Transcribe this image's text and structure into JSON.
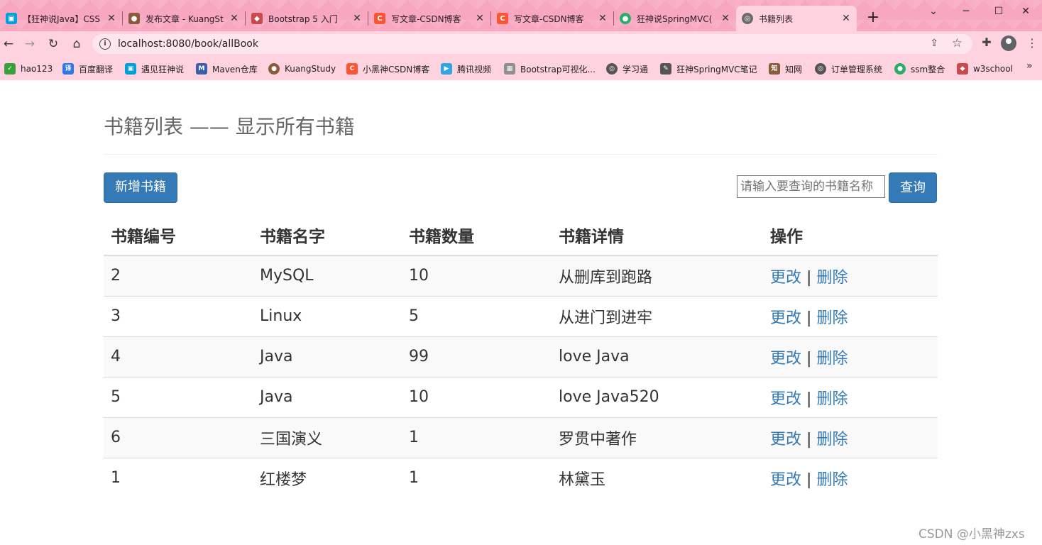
{
  "browser": {
    "tabs": [
      {
        "title": "【狂神说Java】CSS",
        "icon": "bilibili-icon",
        "color": "#00a1d6"
      },
      {
        "title": "发布文章 - KuangSt",
        "icon": "avatar-icon",
        "color": "#8a5a3c"
      },
      {
        "title": "Bootstrap 5 入门",
        "icon": "runoob-icon",
        "color": "#c84a4a"
      },
      {
        "title": "写文章-CSDN博客",
        "icon": "csdn-icon",
        "color": "#fc5531"
      },
      {
        "title": "写文章-CSDN博客",
        "icon": "csdn-icon",
        "color": "#fc5531"
      },
      {
        "title": "狂神说SpringMVC(",
        "icon": "wechat-icon",
        "color": "#2aae67"
      },
      {
        "title": "书籍列表",
        "icon": "globe-icon",
        "color": "#6b6b6b",
        "active": true
      }
    ],
    "url": "localhost:8080/book/allBook",
    "bookmarks": [
      {
        "label": "hao123",
        "icon": "hao123-icon",
        "color": "#3aa13a"
      },
      {
        "label": "百度翻译",
        "icon": "baidu-translate-icon",
        "color": "#2e77e8"
      },
      {
        "label": "遇见狂神说",
        "icon": "bilibili-icon",
        "color": "#00a1d6"
      },
      {
        "label": "Maven仓库",
        "icon": "maven-icon",
        "color": "#3b5fa8"
      },
      {
        "label": "KuangStudy",
        "icon": "avatar-icon",
        "color": "#8a5a3c"
      },
      {
        "label": "小黑神CSDN博客",
        "icon": "csdn-icon",
        "color": "#fc5531"
      },
      {
        "label": "腾讯视频",
        "icon": "tencent-video-icon",
        "color": "#2ea7e0"
      },
      {
        "label": "Bootstrap可视化...",
        "icon": "grid-icon",
        "color": "#8f8f8f"
      },
      {
        "label": "学习通",
        "icon": "globe-icon",
        "color": "#555555"
      },
      {
        "label": "狂神SpringMVC笔记",
        "icon": "feather-icon",
        "color": "#555555"
      },
      {
        "label": "知网",
        "icon": "cnki-icon",
        "color": "#8a5a3c"
      },
      {
        "label": "订单管理系统",
        "icon": "globe-icon",
        "color": "#555555"
      },
      {
        "label": "ssm整合",
        "icon": "wechat-icon",
        "color": "#2aae67"
      },
      {
        "label": "w3school",
        "icon": "runoob-icon",
        "color": "#c84a4a"
      }
    ]
  },
  "page": {
    "title": "书籍列表 —— 显示所有书籍",
    "add_button": "新增书籍",
    "search_placeholder": "请输入要查询的书籍名称",
    "search_button": "查询",
    "table": {
      "headers": [
        "书籍编号",
        "书籍名字",
        "书籍数量",
        "书籍详情",
        "操作"
      ],
      "rows": [
        {
          "id": "2",
          "name": "MySQL",
          "count": "10",
          "detail": "从删库到跑路"
        },
        {
          "id": "3",
          "name": "Linux",
          "count": "5",
          "detail": "从进门到进牢"
        },
        {
          "id": "4",
          "name": "Java",
          "count": "99",
          "detail": "love Java"
        },
        {
          "id": "5",
          "name": "Java",
          "count": "10",
          "detail": "love Java520"
        },
        {
          "id": "6",
          "name": "三国演义",
          "count": "1",
          "detail": "罗贯中著作"
        },
        {
          "id": "1",
          "name": "红楼梦",
          "count": "1",
          "detail": "林黛玉"
        }
      ],
      "edit_label": "更改",
      "separator": "|",
      "delete_label": "删除"
    },
    "watermark": "CSDN @小黑神zxs"
  },
  "colors": {
    "primary": "#337ab7",
    "chrome_pink": "#f7a8c0",
    "toolbar_pink": "#ffd2df",
    "row_stripe": "#f9f9f9"
  }
}
